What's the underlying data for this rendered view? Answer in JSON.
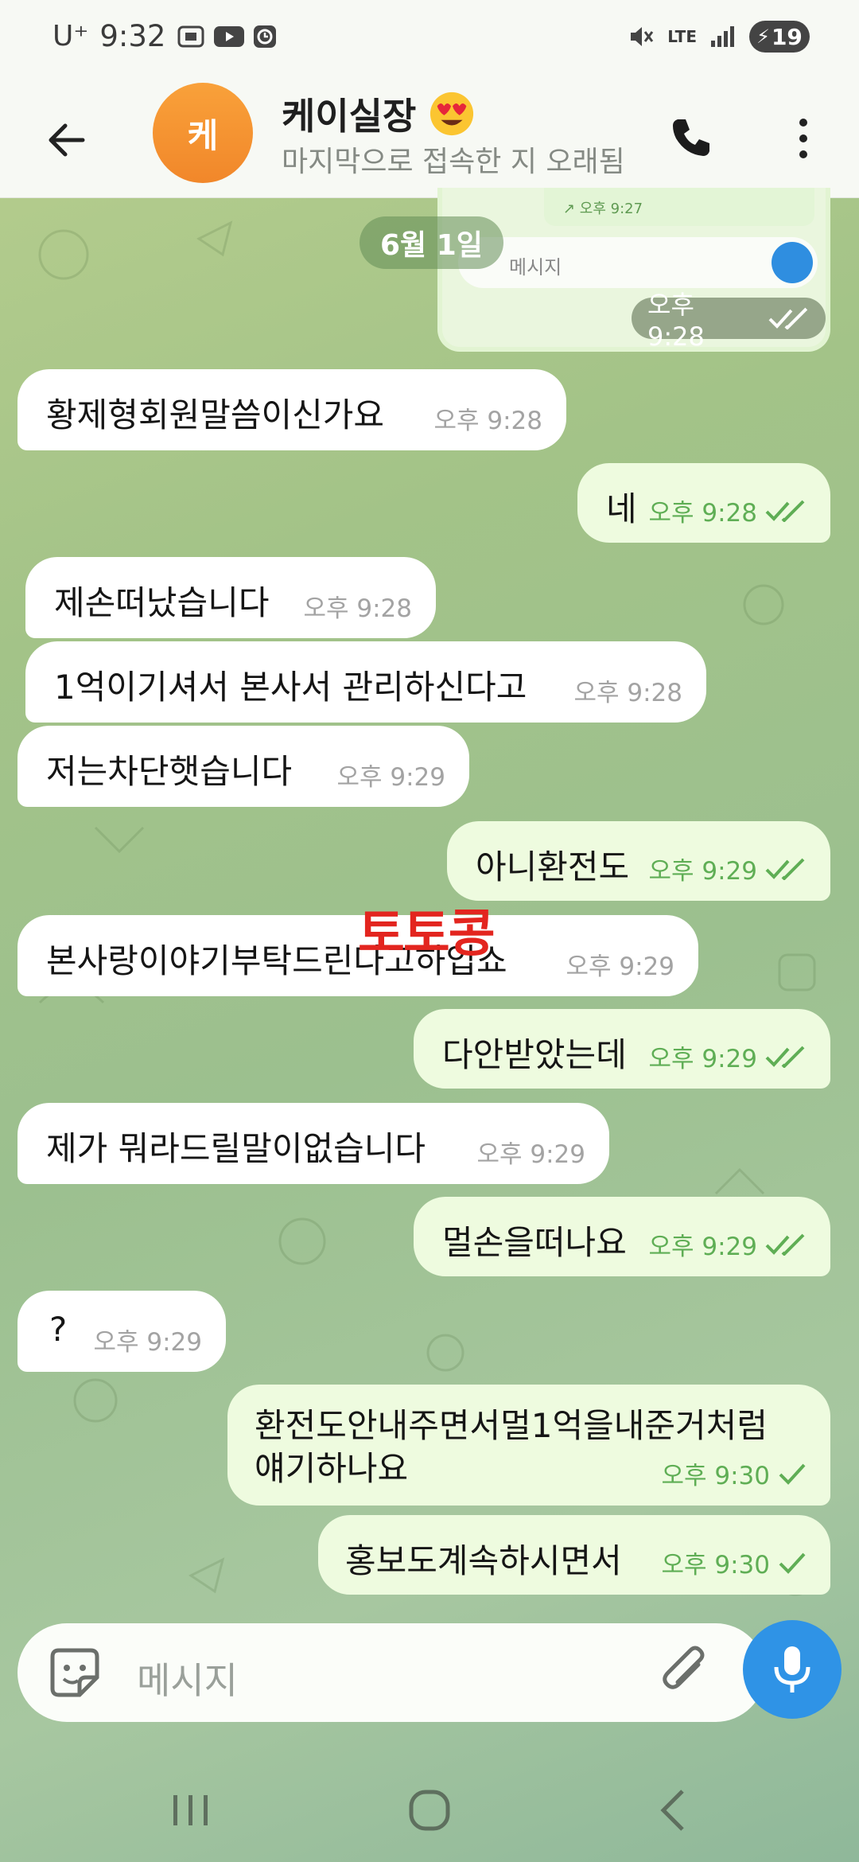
{
  "status_bar": {
    "carrier": "U⁺",
    "time": "9:32",
    "network": "LTE",
    "battery": "19"
  },
  "header": {
    "avatar_letter": "케",
    "contact_name": "케이실장",
    "contact_status": "마지막으로 접속한 지 오래됨"
  },
  "date_label": "6월 1일",
  "image_message": {
    "inner_status": "↗ 오후 9:27",
    "inner_placeholder": "메시지",
    "time": "오후 9:28"
  },
  "messages": [
    {
      "dir": "in",
      "text": "황제형회원말씀이신가요",
      "time": "오후 9:28"
    },
    {
      "dir": "out",
      "text": "네",
      "time": "오후 9:28",
      "status": "read"
    },
    {
      "dir": "in",
      "text": "제손떠났습니다",
      "time": "오후 9:28"
    },
    {
      "dir": "in",
      "text": "1억이기셔서 본사서 관리하신다고",
      "time": "오후 9:28"
    },
    {
      "dir": "in",
      "text": "저는차단햇습니다",
      "time": "오후 9:29"
    },
    {
      "dir": "out",
      "text": "아니환전도",
      "time": "오후 9:29",
      "status": "read"
    },
    {
      "dir": "in",
      "text": "본사랑이야기부탁드린다고하입쇼",
      "time": "오후 9:29"
    },
    {
      "dir": "out",
      "text": "다안받았는데",
      "time": "오후 9:29",
      "status": "read"
    },
    {
      "dir": "in",
      "text": "제가 뭐라드릴말이없습니다",
      "time": "오후 9:29"
    },
    {
      "dir": "out",
      "text": "멀손을떠나요",
      "time": "오후 9:29",
      "status": "read"
    },
    {
      "dir": "in",
      "text": "?",
      "time": "오후 9:29"
    },
    {
      "dir": "out",
      "text_line1": "환전도안내주면서멀1억을내준거처럼",
      "text_line2": "얘기하나요",
      "time": "오후 9:30",
      "status": "sent"
    },
    {
      "dir": "out",
      "text": "홍보도계속하시면서",
      "time": "오후 9:30",
      "status": "sent"
    }
  ],
  "watermark": "토토콩",
  "composer": {
    "placeholder": "메시지"
  },
  "colors": {
    "incoming": "#ffffff",
    "outgoing": "#eefbdf",
    "accent": "#2f93e6",
    "avatar": "#f39332",
    "watermark": "#e3251f"
  }
}
